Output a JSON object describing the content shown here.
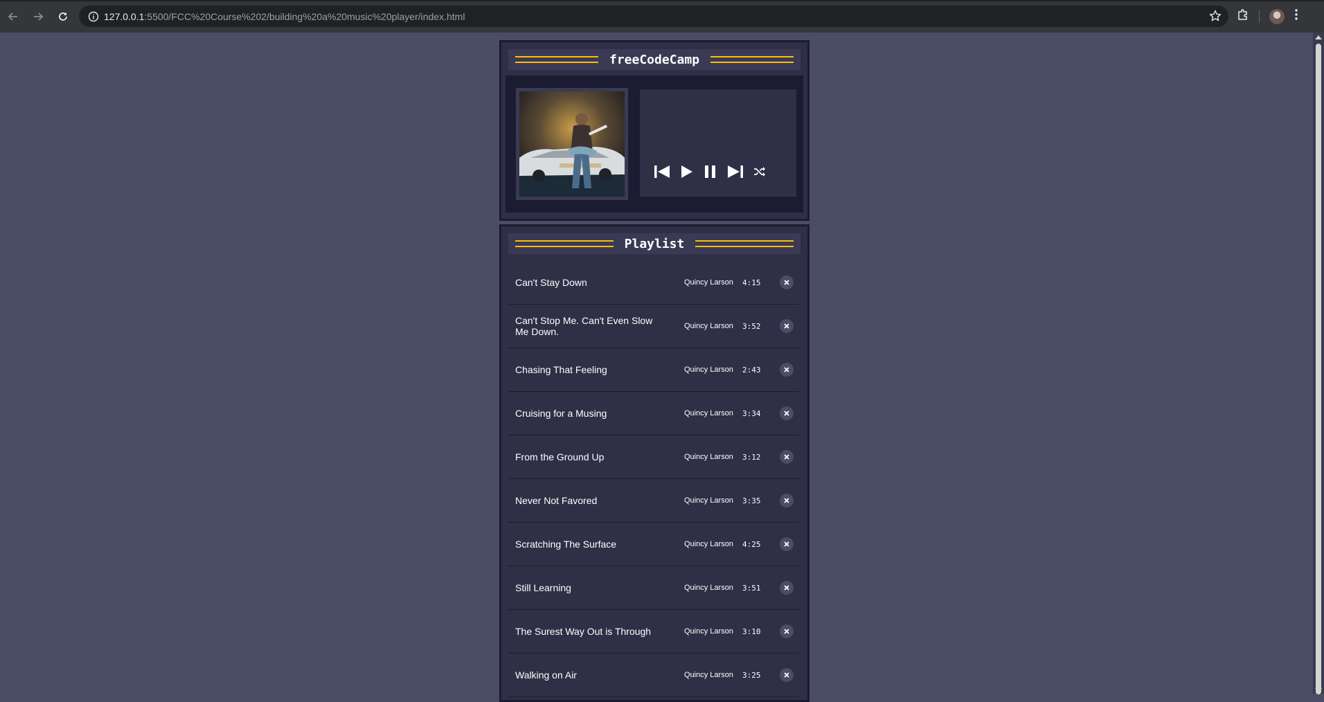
{
  "browser": {
    "url_host": "127.0.0.1",
    "url_rest": ":5500/FCC%20Course%202/building%20a%20music%20player/index.html"
  },
  "player": {
    "title": "freeCodeCamp",
    "controls": [
      {
        "name": "previous-icon"
      },
      {
        "name": "play-icon"
      },
      {
        "name": "pause-icon"
      },
      {
        "name": "next-icon"
      },
      {
        "name": "shuffle-icon"
      }
    ]
  },
  "playlist": {
    "title": "Playlist",
    "songs": [
      {
        "title": "Can't Stay Down",
        "artist": "Quincy Larson",
        "duration": "4:15"
      },
      {
        "title": "Can't Stop Me. Can't Even Slow Me Down.",
        "artist": "Quincy Larson",
        "duration": "3:52"
      },
      {
        "title": "Chasing That Feeling",
        "artist": "Quincy Larson",
        "duration": "2:43"
      },
      {
        "title": "Cruising for a Musing",
        "artist": "Quincy Larson",
        "duration": "3:34"
      },
      {
        "title": "From the Ground Up",
        "artist": "Quincy Larson",
        "duration": "3:12"
      },
      {
        "title": "Never Not Favored",
        "artist": "Quincy Larson",
        "duration": "3:35"
      },
      {
        "title": "Scratching The Surface",
        "artist": "Quincy Larson",
        "duration": "4:25"
      },
      {
        "title": "Still Learning",
        "artist": "Quincy Larson",
        "duration": "3:51"
      },
      {
        "title": "The Surest Way Out is Through",
        "artist": "Quincy Larson",
        "duration": "3:10"
      },
      {
        "title": "Walking on Air",
        "artist": "Quincy Larson",
        "duration": "3:25"
      }
    ]
  },
  "colors": {
    "page_bg": "#4b4d66",
    "panel_bg": "#2f2f46",
    "dark_bg": "#1b1b32",
    "accent": "#ffbf00"
  }
}
